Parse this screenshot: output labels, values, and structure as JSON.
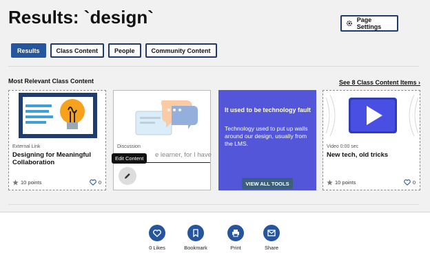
{
  "header": {
    "title": "Results: `design`",
    "page_settings_label": "Page Settings"
  },
  "tabs": [
    {
      "label": "Results",
      "active": true
    },
    {
      "label": "Class Content",
      "active": false
    },
    {
      "label": "People",
      "active": false
    },
    {
      "label": "Community Content",
      "active": false
    }
  ],
  "section": {
    "title": "Most Relevant Class Content",
    "see_all": "See 8 Class Content Items ›"
  },
  "cards": [
    {
      "meta": "External Link",
      "title": "Designing for Meaningful Collaboration",
      "points": "10 points",
      "likes": "0"
    },
    {
      "meta": "Discussion",
      "title": "e learner, for I have",
      "tooltip": "Edit Content"
    },
    {
      "heading": "It used to be technology fault",
      "text": "Technology used to put up walls around our design, usually from the LMS.",
      "button": "VIEW ALL TOOLS"
    },
    {
      "meta": "Video 0:00 sec",
      "title": "New tech, old tricks",
      "points": "10 points",
      "likes": "0"
    }
  ],
  "actions": [
    {
      "label": "0 Likes",
      "icon": "heart-icon"
    },
    {
      "label": "Bookmark",
      "icon": "bookmark-icon"
    },
    {
      "label": "Print",
      "icon": "print-icon"
    },
    {
      "label": "Share",
      "icon": "mail-icon"
    }
  ],
  "colors": {
    "brand": "#25569d",
    "promo": "#5356d8"
  }
}
